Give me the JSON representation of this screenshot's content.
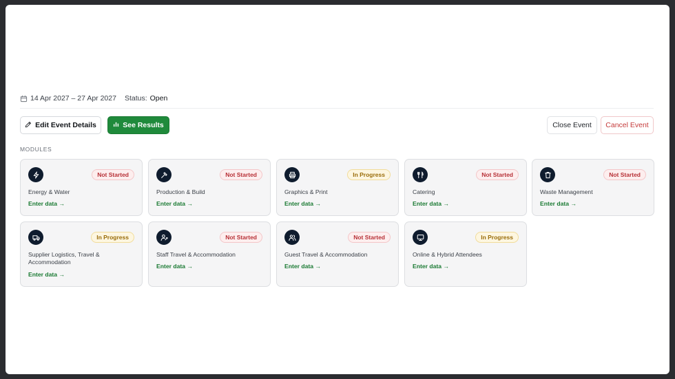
{
  "event": {
    "date_range": "14 Apr 2027 – 27 Apr 2027",
    "status_label": "Status:",
    "status_value": "Open"
  },
  "actions": {
    "edit_label": "Edit Event Details",
    "results_label": "See Results",
    "close_label": "Close Event",
    "cancel_label": "Cancel Event"
  },
  "modules_heading": "MODULES",
  "modules": [
    {
      "title": "Energy & Water",
      "status": "Not Started",
      "icon": "lightning-icon",
      "action": "Enter data →"
    },
    {
      "title": "Production & Build",
      "status": "Not Started",
      "icon": "hammer-icon",
      "action": "Enter data →"
    },
    {
      "title": "Graphics & Print",
      "status": "In Progress",
      "icon": "printer-icon",
      "action": "Enter data →"
    },
    {
      "title": "Catering",
      "status": "Not Started",
      "icon": "utensils-icon",
      "action": "Enter data →"
    },
    {
      "title": "Waste Management",
      "status": "Not Started",
      "icon": "trash-icon",
      "action": "Enter data →"
    },
    {
      "title": "Supplier Logistics, Travel & Accommodation",
      "status": "In Progress",
      "icon": "truck-icon",
      "action": "Enter data →"
    },
    {
      "title": "Staff Travel & Accommodation",
      "status": "Not Started",
      "icon": "user-travel-icon",
      "action": "Enter data →"
    },
    {
      "title": "Guest Travel & Accommodation",
      "status": "Not Started",
      "icon": "users-icon",
      "action": "Enter data →"
    },
    {
      "title": "Online & Hybrid Attendees",
      "status": "In Progress",
      "icon": "monitor-icon",
      "action": "Enter data →"
    }
  ],
  "colors": {
    "accent_green": "#1f8a3b",
    "danger_red": "#c53a3a",
    "icon_navy": "#0f1c2e"
  }
}
